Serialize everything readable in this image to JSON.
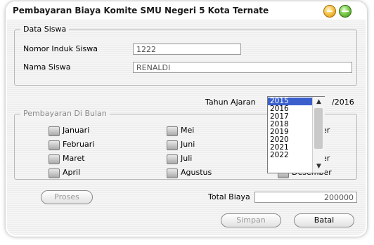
{
  "window": {
    "title": "Pembayaran Biaya Komite SMU Negeri 5 Kota Ternate"
  },
  "data_siswa": {
    "legend": "Data Siswa",
    "nomor_label": "Nomor Induk Siswa",
    "nomor_value": "1222",
    "nama_label": "Nama Siswa",
    "nama_value": "RENALDI"
  },
  "tahun": {
    "label": "Tahun Ajaran",
    "value": "",
    "suffix": "/2016",
    "options": [
      "2015",
      "2016",
      "2017",
      "2018",
      "2019",
      "2020",
      "2021",
      "2022"
    ],
    "selected": "2015"
  },
  "bulan": {
    "legend": "Pembayaran Di Bulan",
    "months": [
      "Januari",
      "Februari",
      "Maret",
      "April",
      "Mei",
      "Juni",
      "Juli",
      "Agustus",
      "ber",
      "ber",
      "Desember"
    ]
  },
  "buttons": {
    "proses": "Proses",
    "simpan": "Simpan",
    "batal": "Batal"
  },
  "total": {
    "label": "Total Biaya",
    "value": "200000"
  },
  "colors": {
    "accent": "#3a5fcd"
  }
}
